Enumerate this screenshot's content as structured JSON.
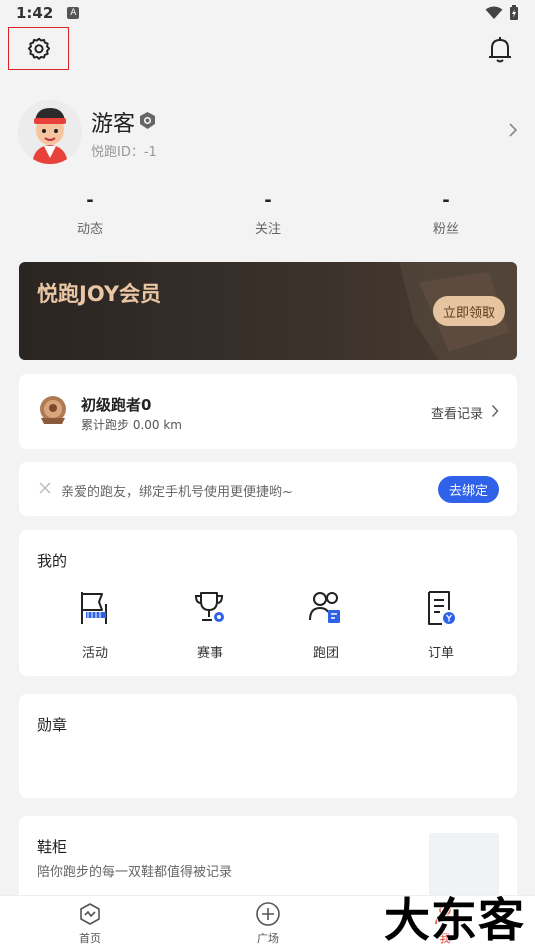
{
  "status_bar": {
    "time": "1:42",
    "notif_letter": "A"
  },
  "profile": {
    "username": "游客",
    "user_id": "悦跑ID：-1"
  },
  "stats": [
    {
      "value": "-",
      "label": "动态"
    },
    {
      "value": "-",
      "label": "关注"
    },
    {
      "value": "-",
      "label": "粉丝"
    }
  ],
  "vip": {
    "title": "悦跑JOY会员",
    "button": "立即领取"
  },
  "level": {
    "name": "初级跑者0",
    "distance": "累计跑步 0.00 km",
    "record_link": "查看记录"
  },
  "bind_phone": {
    "text": "亲爱的跑友，绑定手机号使用更便捷哟~",
    "button": "去绑定"
  },
  "mine": {
    "title": "我的",
    "items": [
      {
        "label": "活动",
        "icon": "activity-flag-icon"
      },
      {
        "label": "赛事",
        "icon": "trophy-icon"
      },
      {
        "label": "跑团",
        "icon": "running-group-icon"
      },
      {
        "label": "订单",
        "icon": "order-icon"
      }
    ]
  },
  "medals": {
    "title": "勋章"
  },
  "shoe_cabinet": {
    "title": "鞋柜",
    "subtitle": "陪你跑步的每一双鞋都值得被记录"
  },
  "tabs": [
    {
      "label": "首页",
      "icon": "home-icon"
    },
    {
      "label": "广场",
      "icon": "plaza-icon"
    },
    {
      "label": "我",
      "icon": "me-icon",
      "active": true
    }
  ],
  "watermark": "大东客",
  "colors": {
    "accent_blue": "#2f62e8",
    "vip_gold": "#e9c6a4",
    "active_tab": "#e3362a"
  }
}
